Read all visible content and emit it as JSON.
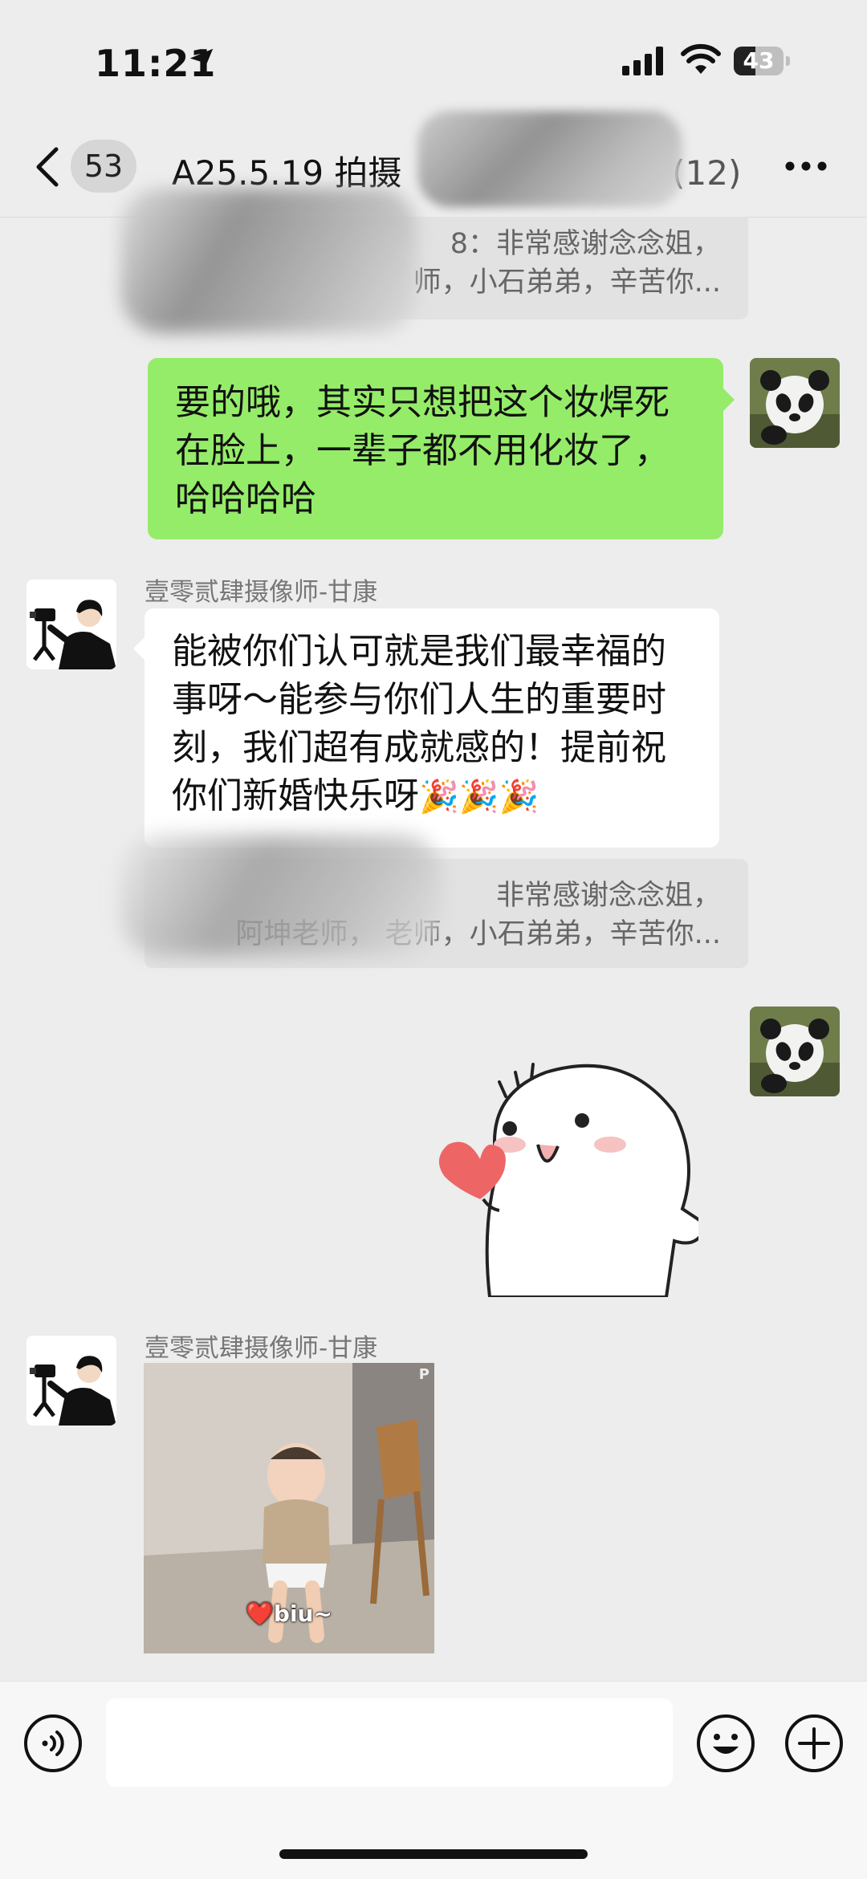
{
  "status_bar": {
    "time": "11:21",
    "battery": "43",
    "battery_level": 0.43
  },
  "nav": {
    "unread_count": "53",
    "title": "A25.5.19 拍摄",
    "member_count": "(12)"
  },
  "colors": {
    "background": "#ededed",
    "my_bubble": "#95ec69",
    "other_bubble": "#ffffff",
    "quote": "#e2e2e2"
  },
  "quotes": [
    {
      "line1": "8：非常感谢念念姐，",
      "line2": "师，小石弟弟，辛苦你..."
    },
    {
      "line1": "非常感谢念念姐，",
      "line2": "阿坤老师，  老师，小石弟弟，辛苦你..."
    }
  ],
  "messages": {
    "me_1": {
      "text": "要的哦，其实只想把这个妆焊死在脸上，一辈子都不用化妆了，哈哈哈哈"
    },
    "gk_1": {
      "sender": "壹零贰肆摄像师-甘康",
      "text": "能被你们认可就是我们最幸福的事呀～能参与你们人生的重要时刻，我们超有成就感的！提前祝你们新婚快乐呀",
      "emoji": "🎉🎉🎉"
    },
    "me_2": {
      "sticker": "heart-sticker"
    },
    "gk_2": {
      "sender": "壹零贰肆摄像师-甘康",
      "image_caption": "❤️biu~",
      "watermark": "P"
    }
  },
  "input": {
    "placeholder": ""
  }
}
